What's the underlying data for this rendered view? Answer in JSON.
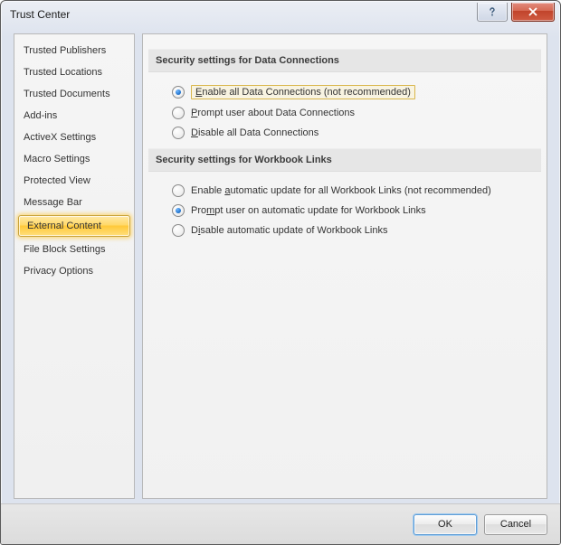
{
  "window": {
    "title": "Trust Center"
  },
  "sidebar": {
    "items": [
      {
        "label": "Trusted Publishers"
      },
      {
        "label": "Trusted Locations"
      },
      {
        "label": "Trusted Documents"
      },
      {
        "label": "Add-ins"
      },
      {
        "label": "ActiveX Settings"
      },
      {
        "label": "Macro Settings"
      },
      {
        "label": "Protected View"
      },
      {
        "label": "Message Bar"
      },
      {
        "label": "External Content"
      },
      {
        "label": "File Block Settings"
      },
      {
        "label": "Privacy Options"
      }
    ],
    "selected_index": 8
  },
  "content": {
    "section1": {
      "title": "Security settings for Data Connections",
      "options": [
        {
          "hotkey": "E",
          "rest": "nable all Data Connections (not recommended)",
          "checked": true,
          "highlight": true
        },
        {
          "hotkey": "P",
          "rest": "rompt user about Data Connections",
          "checked": false,
          "highlight": false
        },
        {
          "hotkey": "D",
          "rest": "isable all Data Connections",
          "checked": false,
          "highlight": false
        }
      ]
    },
    "section2": {
      "title": "Security settings for Workbook Links",
      "options": [
        {
          "prefix": "Enable ",
          "hotkey": "a",
          "rest": "utomatic update for all Workbook Links (not recommended)",
          "checked": false
        },
        {
          "prefix": "Pro",
          "hotkey": "m",
          "rest": "pt user on automatic update for Workbook Links",
          "checked": true
        },
        {
          "prefix": "D",
          "hotkey": "i",
          "rest": "sable automatic update of Workbook Links",
          "checked": false
        }
      ]
    }
  },
  "footer": {
    "ok": "OK",
    "cancel": "Cancel"
  },
  "colors": {
    "accent": "#ffc837",
    "selection_glow": "#ffdf7e"
  }
}
